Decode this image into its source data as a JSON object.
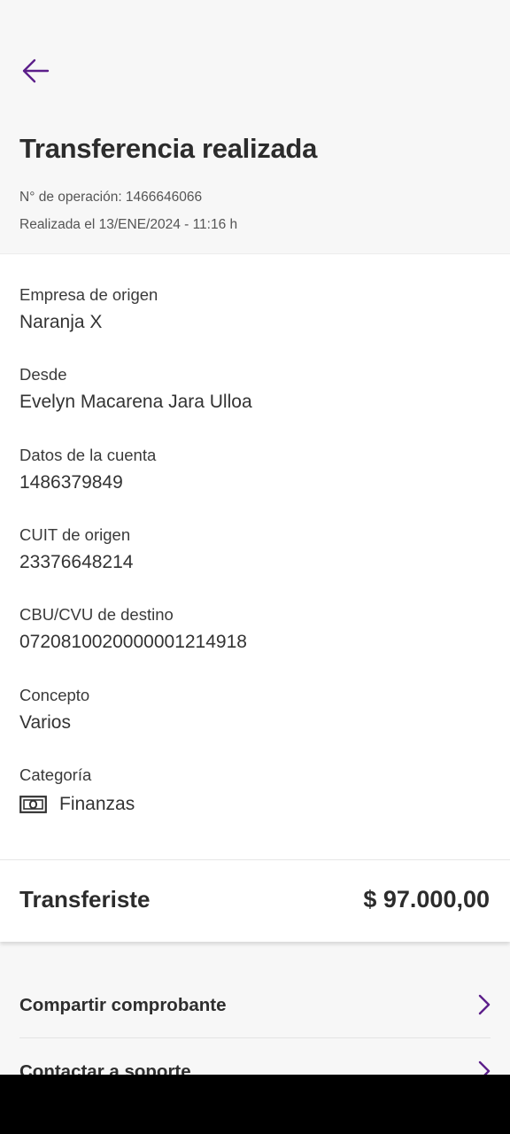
{
  "header": {
    "back_icon": "arrow-left-icon",
    "title": "Transferencia realizada",
    "operation": "N° de operación: 1466646066",
    "date": "Realizada el 13/ENE/2024 - 11:16 h"
  },
  "details": {
    "company_label": "Empresa de origen",
    "company_value": "Naranja X",
    "from_label": "Desde",
    "from_value": "Evelyn Macarena Jara Ulloa",
    "account_label": "Datos de la cuenta",
    "account_value": "1486379849",
    "cuit_label": "CUIT de origen",
    "cuit_value": "23376648214",
    "cbu_label": "CBU/CVU de destino",
    "cbu_value": "0720810020000001214918",
    "concept_label": "Concepto",
    "concept_value": "Varios",
    "category_label": "Categoría",
    "category_value": "Finanzas",
    "category_icon": "banknote-icon"
  },
  "total": {
    "label": "Transferiste",
    "amount": "$ 97.000,00"
  },
  "actions": [
    {
      "label": "Compartir comprobante",
      "icon": "chevron-right-icon"
    },
    {
      "label": "Contactar a soporte",
      "icon": "chevron-right-icon"
    }
  ],
  "colors": {
    "accent": "#5c1f8a",
    "background": "#f7f7f7",
    "card": "#ffffff"
  }
}
